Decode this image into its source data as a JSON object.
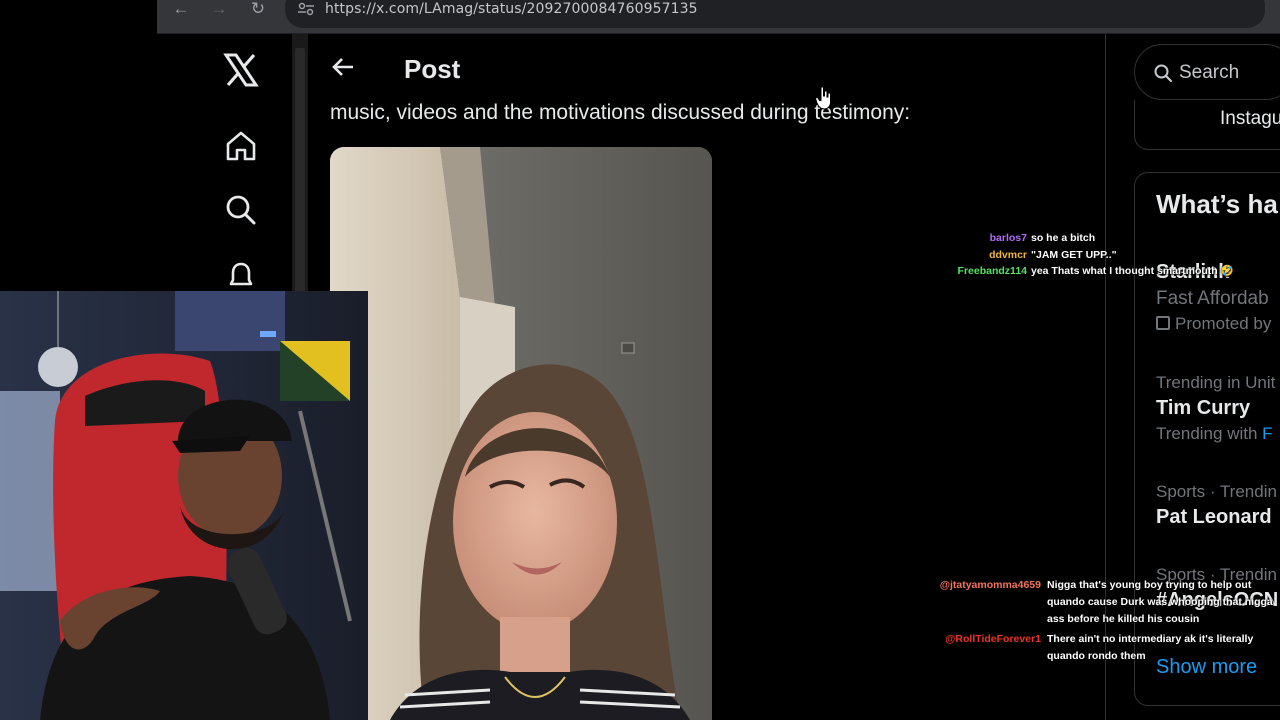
{
  "browser": {
    "url": "https://x.com/LAmag/status/2092700084760957135",
    "back_glyph": "←",
    "forward_glyph": "→",
    "reload_glyph": "↻"
  },
  "post": {
    "title": "Post",
    "text": "music, videos and the motivations discussed during testimony:"
  },
  "sidebar": {
    "search_placeholder": "Search",
    "promo_text": "Instagu",
    "trending_heading": "What’s ha",
    "trends": [
      {
        "meta": "",
        "name": "Starlink",
        "sub": "Fast Affordab",
        "sub2": "Promoted by"
      },
      {
        "meta": "Trending in Unit",
        "name": "Tim Curry",
        "sub": "Trending with",
        "sub_link": "F"
      },
      {
        "meta": "Sports · Trendin",
        "name": "Pat Leonard"
      },
      {
        "meta": "Sports · Trendin",
        "name": "#AngelsOCN"
      }
    ],
    "show_more": "Show more"
  },
  "chat": {
    "messages": [
      {
        "user": "barlos7",
        "text": "so he a bitch",
        "color": "#b06cf5"
      },
      {
        "user": "ddvmcr",
        "text": "\"JAM GET UPP..\"",
        "color": "#f0b640"
      },
      {
        "user": "Freebandz114",
        "text": "yea Thats what I thought smartmouth 🤣",
        "color": "#57e067"
      },
      {
        "user": "@jtatyamomma4659",
        "text_lines": [
          "Nigga that's young boy trying to help out",
          "quando cause Durk was whooping that nigga",
          "ass before he killed his cousin"
        ],
        "color": "#f2745e"
      },
      {
        "user": "@RollTideForever1",
        "text_lines": [
          "There ain't no intermediary ak it's literally",
          "quando rondo them"
        ],
        "color": "#e8342a"
      }
    ]
  },
  "colors": {
    "accent": "#1d9bf0",
    "background": "#000000",
    "border": "#2f3336"
  }
}
